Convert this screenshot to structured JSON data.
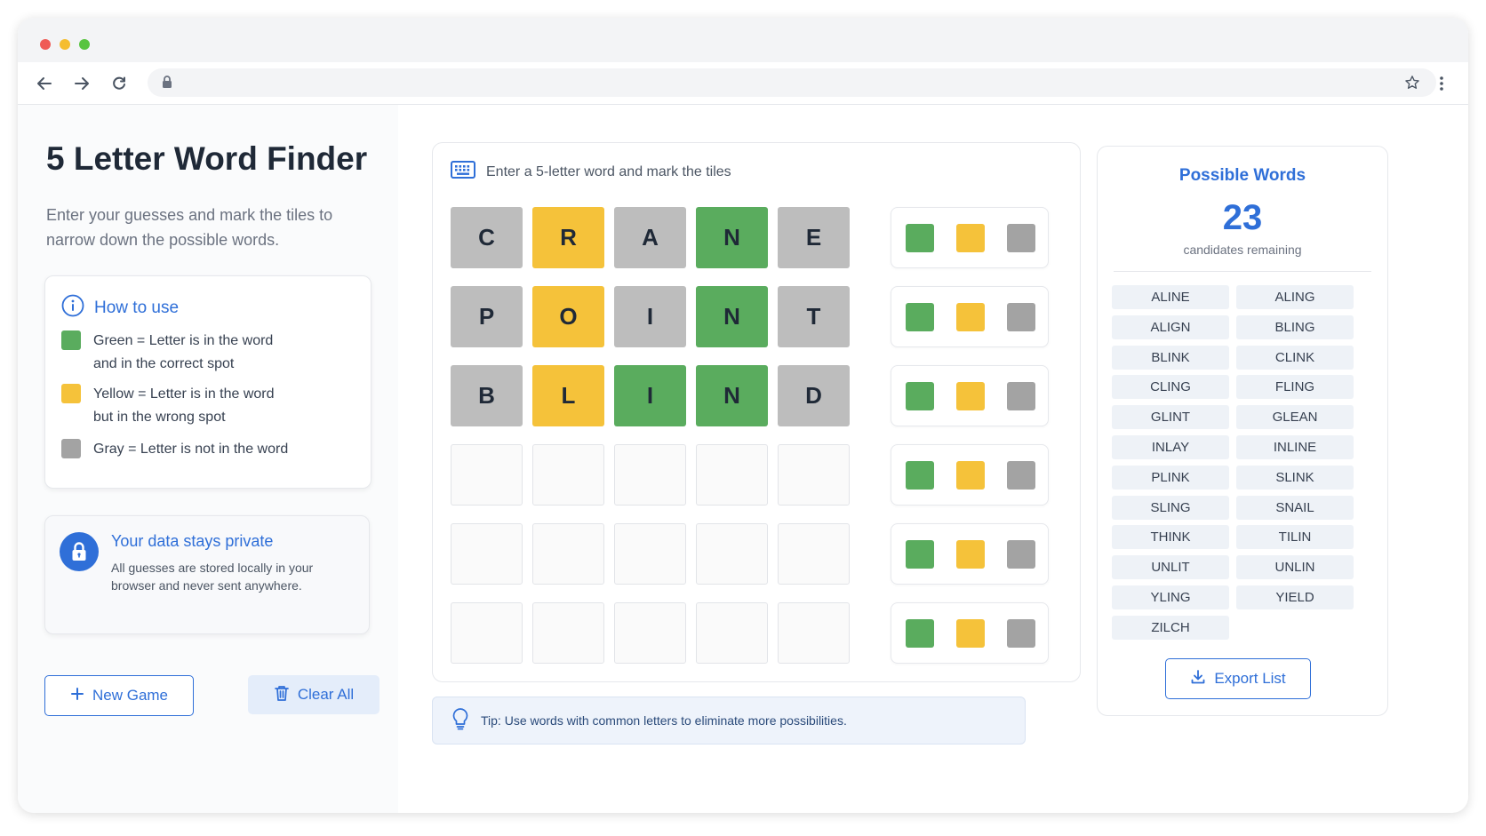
{
  "browser": {
    "address": "",
    "icons": [
      "back-icon",
      "forward-icon",
      "reload-icon",
      "lock-icon",
      "star-icon",
      "menu-icon"
    ]
  },
  "sidebar": {
    "title": "5 Letter Word Finder",
    "subtitle": "Enter your guesses and mark the tiles to narrow down the possible words.",
    "how_to": {
      "title": "How to use",
      "items": [
        {
          "color": "green",
          "text": "Green = Letter is in the word and in the correct spot"
        },
        {
          "color": "yellow",
          "text": "Yellow = Letter is in the word but in the wrong spot"
        },
        {
          "color": "gray",
          "text": "Gray = Letter is not in the word"
        }
      ]
    },
    "privacy": {
      "title": "Your data stays private",
      "text": "All guesses are stored locally in your browser and never sent anywhere."
    },
    "buttons": {
      "new_game": "New Game",
      "clear_all": "Clear All"
    }
  },
  "board": {
    "instruction": "Enter a 5-letter word and mark the tiles",
    "rows": [
      {
        "letters": [
          "C",
          "R",
          "A",
          "N",
          "E"
        ],
        "states": [
          "gray",
          "yellow",
          "gray",
          "green",
          "gray"
        ]
      },
      {
        "letters": [
          "P",
          "O",
          "I",
          "N",
          "T"
        ],
        "states": [
          "gray",
          "yellow",
          "gray",
          "green",
          "gray"
        ]
      },
      {
        "letters": [
          "B",
          "L",
          "I",
          "N",
          "D"
        ],
        "states": [
          "gray",
          "yellow",
          "green",
          "green",
          "gray"
        ]
      },
      {
        "letters": [
          "",
          "",
          "",
          "",
          ""
        ],
        "states": [
          "empty",
          "empty",
          "empty",
          "empty",
          "empty"
        ]
      },
      {
        "letters": [
          "",
          "",
          "",
          "",
          ""
        ],
        "states": [
          "empty",
          "empty",
          "empty",
          "empty",
          "empty"
        ]
      },
      {
        "letters": [
          "",
          "",
          "",
          "",
          ""
        ],
        "states": [
          "empty",
          "empty",
          "empty",
          "empty",
          "empty"
        ]
      }
    ],
    "tip": "Tip: Use words with common letters to eliminate more possibilities."
  },
  "results": {
    "title": "Possible Words",
    "count": "23",
    "count_label": "candidates remaining",
    "words": [
      "ALINE",
      "ALING",
      "ALIGN",
      "BLING",
      "BLINK",
      "CLINK",
      "CLING",
      "FLING",
      "GLINT",
      "GLEAN",
      "INLAY",
      "INLINE",
      "PLINK",
      "SLINK",
      "SLING",
      "SNAIL",
      "THINK",
      "TILIN",
      "UNLIT",
      "UNLIN",
      "YLING",
      "YIELD",
      "ZILCH"
    ],
    "export_label": "Export List"
  },
  "colors": {
    "accent": "#2f6fd8",
    "green": "#5aac5e",
    "yellow": "#f5c23a",
    "gray": "#bdbdbd"
  }
}
